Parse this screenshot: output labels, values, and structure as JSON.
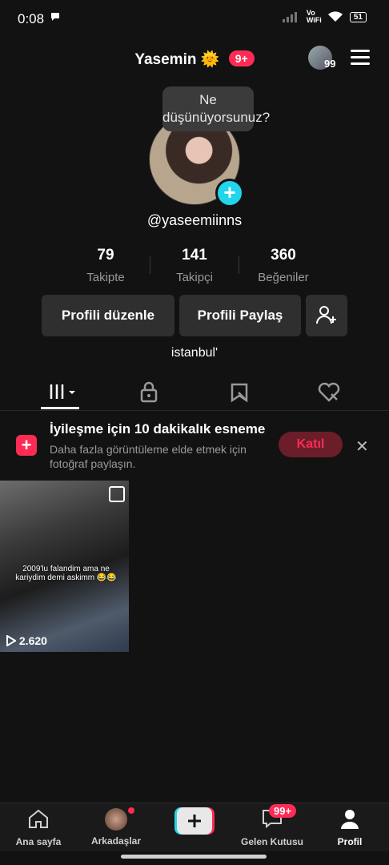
{
  "status_bar": {
    "time": "0:08",
    "battery": "51",
    "network": "Vo WiFi"
  },
  "header": {
    "name": "Yasemin",
    "emoji": "🌞",
    "badge": "9+",
    "avatar_count": "99"
  },
  "profile": {
    "bubble": "Ne düşünüyorsunuz?",
    "username": "@yaseemiinns",
    "stats": [
      {
        "value": "79",
        "label": "Takipte"
      },
      {
        "value": "141",
        "label": "Takipçi"
      },
      {
        "value": "360",
        "label": "Beğeniler"
      }
    ],
    "buttons": {
      "edit": "Profili düzenle",
      "share": "Profili Paylaş"
    },
    "location": "istanbul'"
  },
  "banner": {
    "title": "İyileşme için 10 dakikalık esneme",
    "desc": "Daha fazla görüntüleme elde etmek için fotoğraf paylaşın.",
    "join": "Katıl"
  },
  "video": {
    "caption": "2009'lu falandim ama ne kariydim demi askimm 😂😂",
    "views": "2.620"
  },
  "nav": {
    "home": "Ana sayfa",
    "friends": "Arkadaşlar",
    "inbox": "Gelen Kutusu",
    "inbox_badge": "99+",
    "profile": "Profil"
  },
  "colors": {
    "accent": "#fe2c55",
    "cyan": "#20d5ec",
    "background": "#121212"
  }
}
